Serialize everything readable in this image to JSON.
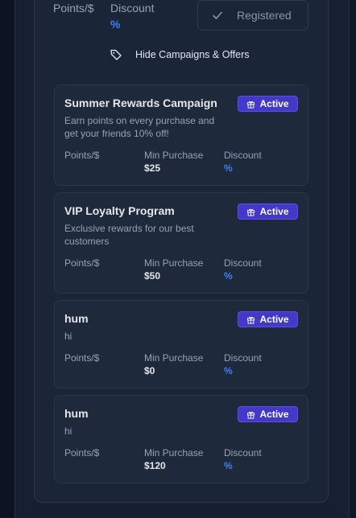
{
  "top_stats": {
    "points_label": "Points/$",
    "discount_label": "Discount",
    "discount_value": "%"
  },
  "registered_button": {
    "label": "Registered",
    "icon": "check-icon"
  },
  "hide_link": {
    "label": "Hide Campaigns & Offers",
    "icon": "tag-icon"
  },
  "campaigns": [
    {
      "title": "Summer Rewards Campaign",
      "description": "Earn points on every purchase and get your friends 10% off!",
      "status": "Active",
      "points_label": "Points/$",
      "min_purchase_label": "Min Purchase",
      "min_purchase_value": "$25",
      "discount_label": "Discount",
      "discount_value": "%"
    },
    {
      "title": "VIP Loyalty Program",
      "description": "Exclusive rewards for our best customers",
      "status": "Active",
      "points_label": "Points/$",
      "min_purchase_label": "Min Purchase",
      "min_purchase_value": "$50",
      "discount_label": "Discount",
      "discount_value": "%"
    },
    {
      "title": "hum",
      "description": "hi",
      "status": "Active",
      "points_label": "Points/$",
      "min_purchase_label": "Min Purchase",
      "min_purchase_value": "$0",
      "discount_label": "Discount",
      "discount_value": "%"
    },
    {
      "title": "hum",
      "description": "hi",
      "status": "Active",
      "points_label": "Points/$",
      "min_purchase_label": "Min Purchase",
      "min_purchase_value": "$120",
      "discount_label": "Discount",
      "discount_value": "%"
    }
  ],
  "colors": {
    "accent_blue": "#3b82f6",
    "badge_bg": "#4338ca",
    "background": "#0f172a"
  }
}
